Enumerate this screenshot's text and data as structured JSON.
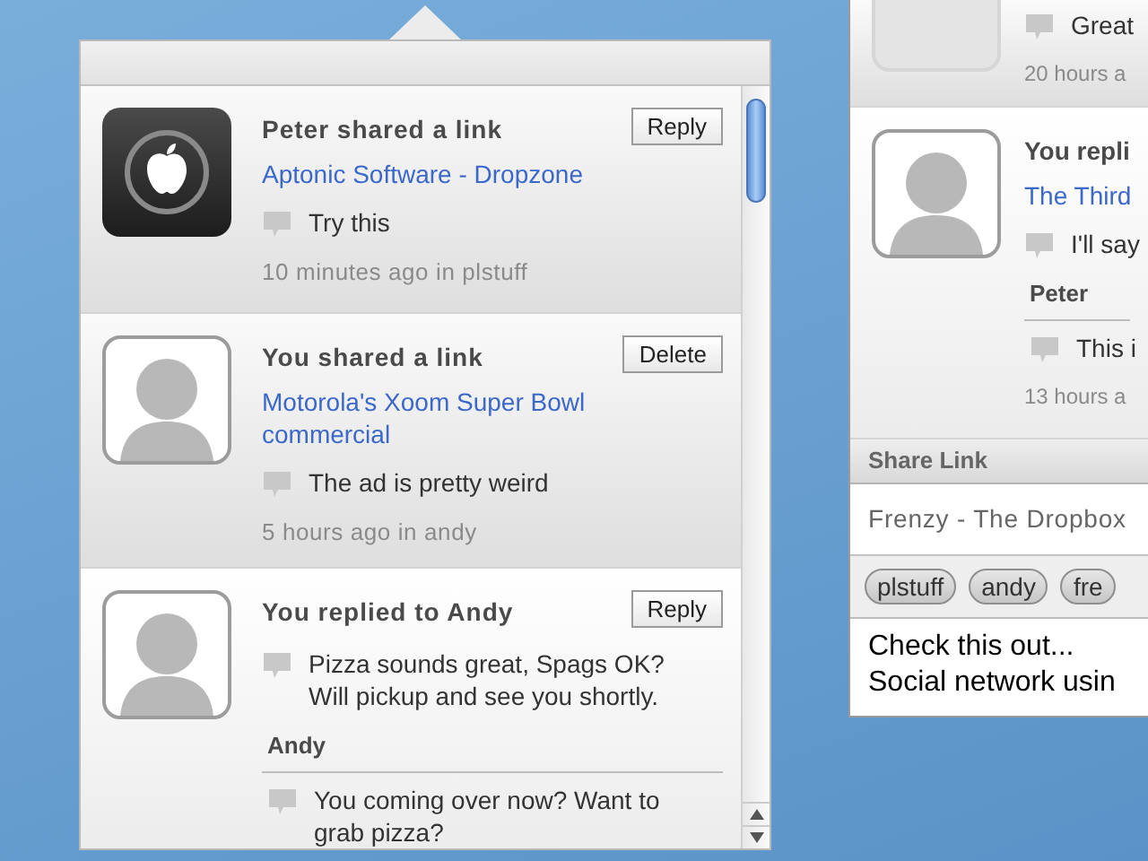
{
  "popover": {
    "items": [
      {
        "kind": "apple",
        "highlighted": true,
        "title": "Peter shared a link",
        "action": "Reply",
        "link": "Aptonic Software - Dropzone",
        "comment": "Try this",
        "time": "10 minutes ago in plstuff"
      },
      {
        "kind": "person",
        "highlighted": true,
        "title": "You shared a link",
        "action": "Delete",
        "link": "Motorola's Xoom Super Bowl commercial",
        "comment": "The ad is pretty weird",
        "time": "5 hours ago in andy"
      },
      {
        "kind": "person",
        "highlighted": false,
        "title": "You replied to Andy",
        "action": "Reply",
        "comment": "Pizza sounds great, Spags OK? Will pickup and see you shortly.",
        "thread_author": "Andy",
        "thread_comment": "You coming over now? Want to grab pizza?"
      }
    ]
  },
  "side_window": {
    "items": [
      {
        "kind": "faded",
        "highlighted": true,
        "comment": "Great",
        "time": "20 hours a"
      },
      {
        "kind": "person",
        "highlighted": false,
        "title": "You repli",
        "link": "The Third",
        "comment": "I'll say",
        "thread_author": "Peter",
        "thread_comment": "This i",
        "time": "13 hours a"
      }
    ],
    "share_link": {
      "title": "Share Link",
      "url": "Frenzy - The Dropbox",
      "tags": [
        "plstuff",
        "andy",
        "fre"
      ],
      "message": [
        "Check this out...",
        "Social network usin"
      ]
    }
  }
}
